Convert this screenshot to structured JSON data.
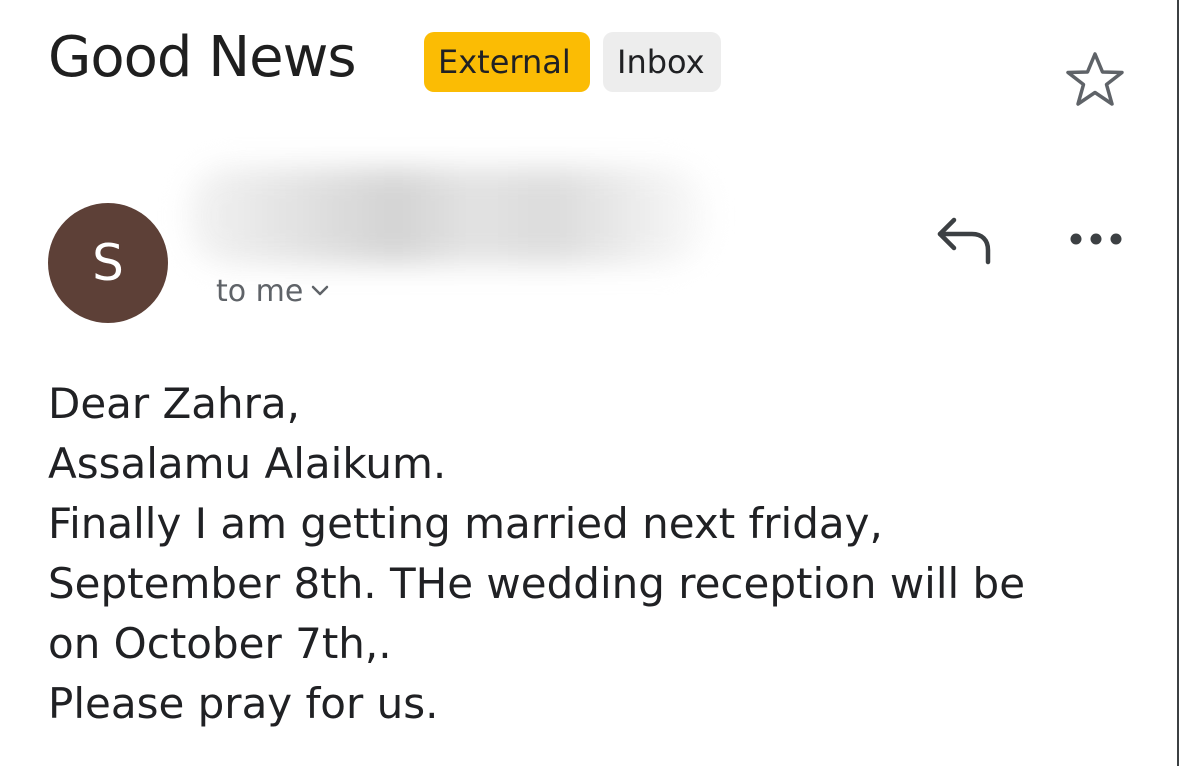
{
  "email": {
    "subject": "Good News",
    "labels": {
      "external": "External",
      "inbox": "Inbox"
    },
    "sender": {
      "avatar_initial": "S",
      "avatar_color": "#5d4037",
      "recipient_text": "to me"
    },
    "body_lines": [
      "Dear Zahra,",
      "Assalamu Alaikum.",
      "Finally I am getting married next friday,",
      "September 8th. THe wedding reception will be",
      "on October 7th,.",
      "Please pray for us."
    ]
  },
  "icons": {
    "star": "star-outline-icon",
    "reply": "reply-icon",
    "more": "more-horizontal-icon",
    "recipient_expand": "chevron-down-icon"
  },
  "colors": {
    "external_badge": "#fbbc04",
    "inbox_badge": "#ededed",
    "avatar": "#5d4037"
  }
}
